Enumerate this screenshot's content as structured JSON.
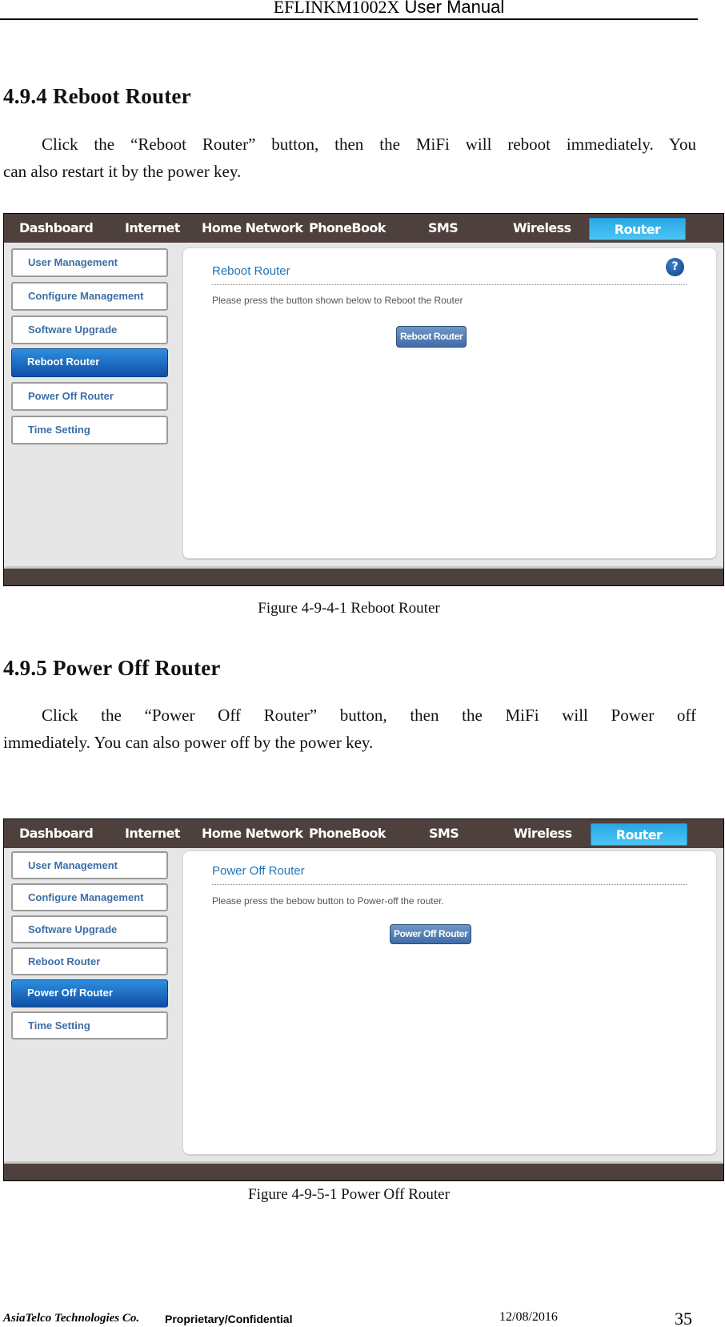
{
  "header": {
    "title_serif": "EFLINKM1002X",
    "title_sans": "User Manual"
  },
  "sections": [
    {
      "heading": "4.9.4 Reboot Router",
      "paragraph_line1": "Click the “Reboot Router” button, then the MiFi will reboot immediately. You",
      "paragraph_line2": "can also restart it by the power key.",
      "figure_caption": "Figure 4-9-4-1 Reboot Router",
      "screenshot": {
        "nav": [
          "Dashboard",
          "Internet",
          "Home Network",
          "PhoneBook",
          "SMS",
          "Wireless",
          "Router"
        ],
        "active_nav": "Router",
        "sidebar": [
          "User Management",
          "Configure Management",
          "Software Upgrade",
          "Reboot Router",
          "Power Off Router",
          "Time Setting"
        ],
        "selected_sidebar": "Reboot Router",
        "panel_title": "Reboot Router",
        "panel_description": "Please press the button shown below to Reboot the Router",
        "action_button": "Reboot Router",
        "help_icon": "?"
      }
    },
    {
      "heading": "4.9.5 Power Off Router",
      "paragraph_line1": "Click the “Power Off Router” button, then the MiFi will Power off",
      "paragraph_line2": "immediately. You can also power off by the power key.",
      "figure_caption": "Figure 4-9-5-1 Power Off Router",
      "screenshot": {
        "nav": [
          "Dashboard",
          "Internet",
          "Home Network",
          "PhoneBook",
          "SMS",
          "Wireless",
          "Router"
        ],
        "active_nav": "Router",
        "sidebar": [
          "User Management",
          "Configure Management",
          "Software Upgrade",
          "Reboot Router",
          "Power Off Router",
          "Time Setting"
        ],
        "selected_sidebar": "Power Off Router",
        "panel_title": "Power Off Router",
        "panel_description": "Please press the bebow button to Power-off the router.",
        "action_button": "Power Off Router"
      }
    }
  ],
  "footer": {
    "company": "AsiaTelco Technologies Co.",
    "confidentiality": "Proprietary/Confidential",
    "date": "12/08/2016",
    "page_number": "35"
  },
  "colors": {
    "nav_bg": "#4e403c",
    "active_tab": "#2aa6e6",
    "selected_sidebar": "#1a63bf",
    "panel_title": "#1f74b8",
    "sidebar_text": "#3d6fa6"
  }
}
